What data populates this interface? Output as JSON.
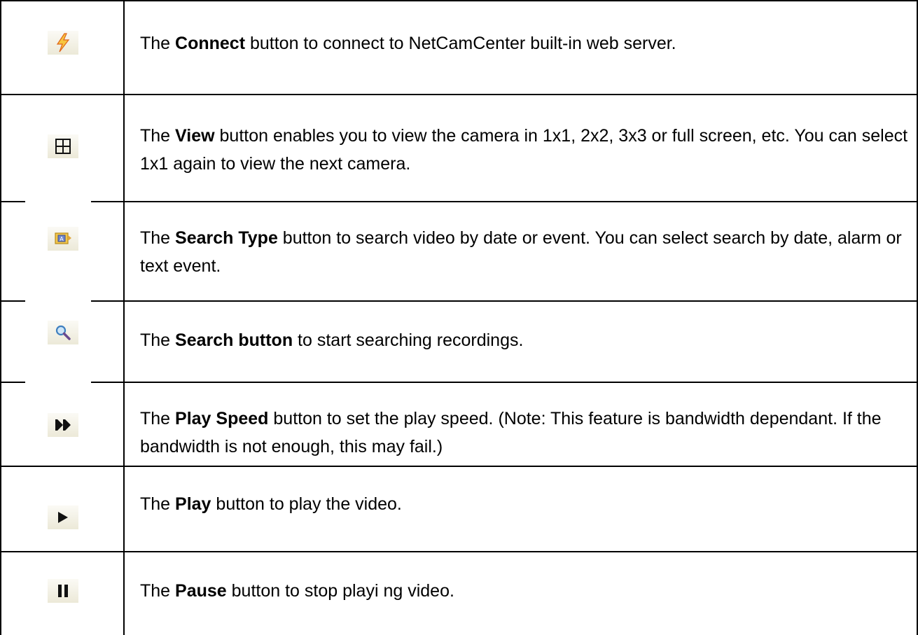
{
  "rows": [
    {
      "icon": "lightning-icon",
      "pre": "The ",
      "bold": "Connect",
      "post": " button to connect to NetCamCenter built-in web server."
    },
    {
      "icon": "grid-view-icon",
      "pre": "The ",
      "bold": "View",
      "post": " button enables you to view the camera in 1x1, 2x2, 3x3 or full screen, etc. You can select 1x1 again to view the next camera."
    },
    {
      "icon": "search-type-icon",
      "pre": "The ",
      "bold": "Search Type",
      "post": " button to search video by date or event. You can select search by date, alarm or text event."
    },
    {
      "icon": "magnifier-icon",
      "pre": "The ",
      "bold": "Search button",
      "post": " to start searching recordings."
    },
    {
      "icon": "fast-forward-icon",
      "pre": "The ",
      "bold": "Play Speed",
      "post": " button to set the play speed. (Note: This feature is bandwidth dependant. If the bandwidth is not enough, this may fail.)"
    },
    {
      "icon": "play-icon",
      "pre": "The ",
      "bold": "Play",
      "post": " button to play the video."
    },
    {
      "icon": "pause-icon",
      "pre": "The ",
      "bold": "Pause",
      "post": " button to stop playi ng video."
    }
  ]
}
